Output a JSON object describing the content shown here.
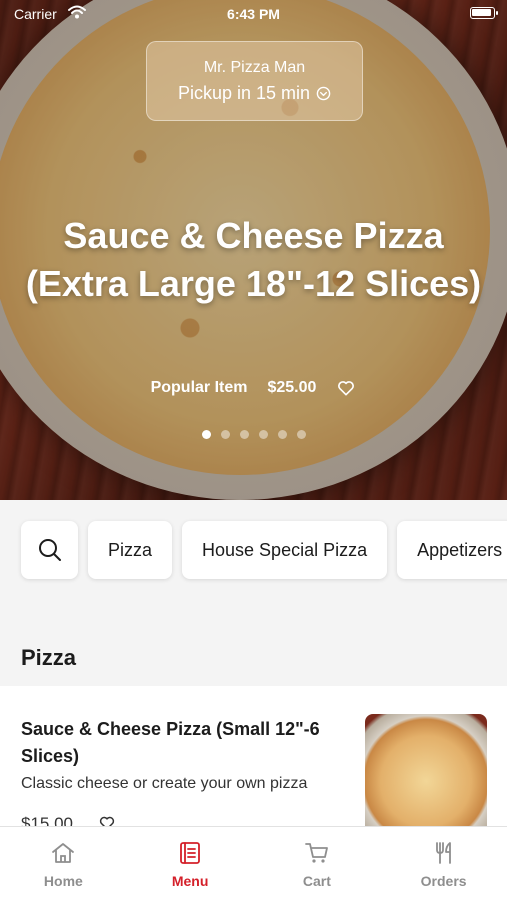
{
  "status_bar": {
    "carrier": "Carrier",
    "time": "6:43 PM"
  },
  "store": {
    "name": "Mr. Pizza Man",
    "pickup": "Pickup in 15 min"
  },
  "hero": {
    "title": "Sauce & Cheese Pizza (Extra Large 18\"-12 Slices)",
    "badge": "Popular Item",
    "price": "$25.00",
    "carousel_total": 6,
    "carousel_active_index": 0
  },
  "categories": [
    "Pizza",
    "House Special Pizza",
    "Appetizers"
  ],
  "section": {
    "title": "Pizza"
  },
  "item": {
    "name": "Sauce & Cheese Pizza (Small 12\"-6 Slices)",
    "description": "Classic cheese or create your own pizza",
    "price": "$15.00"
  },
  "tabs": [
    {
      "label": "Home",
      "icon": "home-icon"
    },
    {
      "label": "Menu",
      "icon": "menu-icon"
    },
    {
      "label": "Cart",
      "icon": "cart-icon"
    },
    {
      "label": "Orders",
      "icon": "fork-knife-icon"
    }
  ],
  "active_tab": "Menu",
  "colors": {
    "accent": "#d4202a",
    "inactive": "#8e8e8e"
  }
}
